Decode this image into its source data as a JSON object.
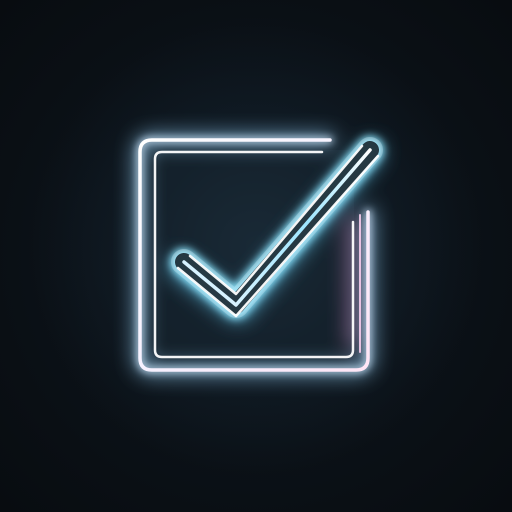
{
  "icon": {
    "name": "checkbox-checked-icon",
    "style": "neon"
  },
  "colors": {
    "background": "#0b1117",
    "tube_core": "#ffffff",
    "tube_glow_blue": "#5fd3ff",
    "tube_glow_pink": "#ff9de8",
    "inner_fill": "#16242f"
  }
}
